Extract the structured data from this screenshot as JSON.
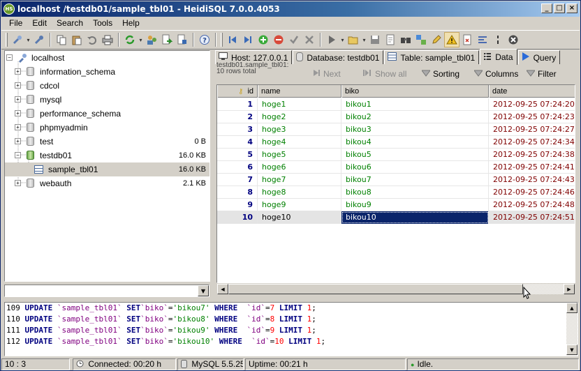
{
  "window": {
    "title": "localhost /testdb01/sample_tbl01 - HeidiSQL 7.0.0.4053",
    "app_icon": "heidisql-icon",
    "controls": {
      "minimize": "_",
      "maximize": "□",
      "close": "×"
    }
  },
  "menu": [
    "File",
    "Edit",
    "Search",
    "Tools",
    "Help"
  ],
  "toolbar": {
    "icons": [
      "connect-icon",
      "disconnect-icon",
      "copy-icon",
      "paste-icon",
      "undo-icon",
      "print-icon",
      "refresh-icon",
      "user-manager-icon",
      "export-icon",
      "import-icon",
      "help-icon",
      "first-record-icon",
      "last-record-icon",
      "add-record-icon",
      "delete-record-icon",
      "post-record-icon",
      "cancel-record-icon",
      "run-icon",
      "open-sql-icon",
      "save-sql-icon",
      "save-snippet-icon",
      "find-icon",
      "replace-icon",
      "edit-icon",
      "warning-icon",
      "explain-icon",
      "format-icon",
      "stop-icon"
    ]
  },
  "tree": {
    "root": "localhost",
    "databases": [
      {
        "name": "information_schema",
        "size": "",
        "expanded": false
      },
      {
        "name": "cdcol",
        "size": "",
        "expanded": false
      },
      {
        "name": "mysql",
        "size": "",
        "expanded": false
      },
      {
        "name": "performance_schema",
        "size": "",
        "expanded": false
      },
      {
        "name": "phpmyadmin",
        "size": "",
        "expanded": false
      },
      {
        "name": "test",
        "size": "0 B",
        "expanded": false
      },
      {
        "name": "testdb01",
        "size": "16.0 KB",
        "expanded": true
      },
      {
        "name": "webauth",
        "size": "2.1 KB",
        "expanded": false
      }
    ],
    "table": {
      "name": "sample_tbl01",
      "size": "16.0 KB",
      "selected": true
    },
    "filter_value": ""
  },
  "tabs": [
    {
      "label": "Host: 127.0.0.1",
      "icon": "host-icon",
      "active": false
    },
    {
      "label": "Database: testdb01",
      "icon": "database-icon",
      "active": false
    },
    {
      "label": "Table: sample_tbl01",
      "icon": "table-icon",
      "active": false
    },
    {
      "label": "Data",
      "icon": "data-icon",
      "active": true
    },
    {
      "label": "Query",
      "icon": "query-icon",
      "active": false
    }
  ],
  "data_toolbar": {
    "row_info_line1": "testdb01.sample_tbl01:",
    "row_info_line2": "10 rows total",
    "next": "Next",
    "show_all": "Show all",
    "sorting": "Sorting",
    "columns": "Columns",
    "filter": "Filter"
  },
  "grid": {
    "columns": [
      "id",
      "name",
      "biko",
      "date"
    ],
    "key_column": "id",
    "rows": [
      [
        "1",
        "hoge1",
        "bikou1",
        "2012-09-25 07:24:20"
      ],
      [
        "2",
        "hoge2",
        "bikou2",
        "2012-09-25 07:24:23"
      ],
      [
        "3",
        "hoge3",
        "bikou3",
        "2012-09-25 07:24:27"
      ],
      [
        "4",
        "hoge4",
        "bikou4",
        "2012-09-25 07:24:34"
      ],
      [
        "5",
        "hoge5",
        "bikou5",
        "2012-09-25 07:24:38"
      ],
      [
        "6",
        "hoge6",
        "bikou6",
        "2012-09-25 07:24:41"
      ],
      [
        "7",
        "hoge7",
        "bikou7",
        "2012-09-25 07:24:43"
      ],
      [
        "8",
        "hoge8",
        "bikou8",
        "2012-09-25 07:24:46"
      ],
      [
        "9",
        "hoge9",
        "bikou9",
        "2012-09-25 07:24:48"
      ],
      [
        "10",
        "hoge10",
        "bikou10",
        "2012-09-25 07:24:51"
      ]
    ],
    "focused_row": 9,
    "focused_column": 2
  },
  "sql_log": [
    {
      "line": "109",
      "table": "`sample_tbl01`",
      "col": "`biko`",
      "value": "'bikou7'",
      "id": "7"
    },
    {
      "line": "110",
      "table": "`sample_tbl01`",
      "col": "`biko`",
      "value": "'bikou8'",
      "id": "8"
    },
    {
      "line": "111",
      "table": "`sample_tbl01`",
      "col": "`biko`",
      "value": "'bikou9'",
      "id": "9"
    },
    {
      "line": "112",
      "table": "`sample_tbl01`",
      "col": "`biko`",
      "value": "'bikou10'",
      "id": "10"
    }
  ],
  "sql_keywords": {
    "update": "UPDATE",
    "set": "SET",
    "where": "WHERE",
    "limit": "LIMIT",
    "id_col": "`id`",
    "limit_val": "1"
  },
  "status": {
    "position": "10 : 3",
    "connected": "Connected: 00:20 h",
    "server": "MySQL 5.5.25",
    "uptime": "Uptime: 00:21 h",
    "state": "Idle."
  },
  "colors": {
    "titlebar_start": "#0a246a",
    "selection": "#0a246a",
    "id_color": "#000080",
    "text_color": "#008000",
    "date_color": "#800000"
  }
}
